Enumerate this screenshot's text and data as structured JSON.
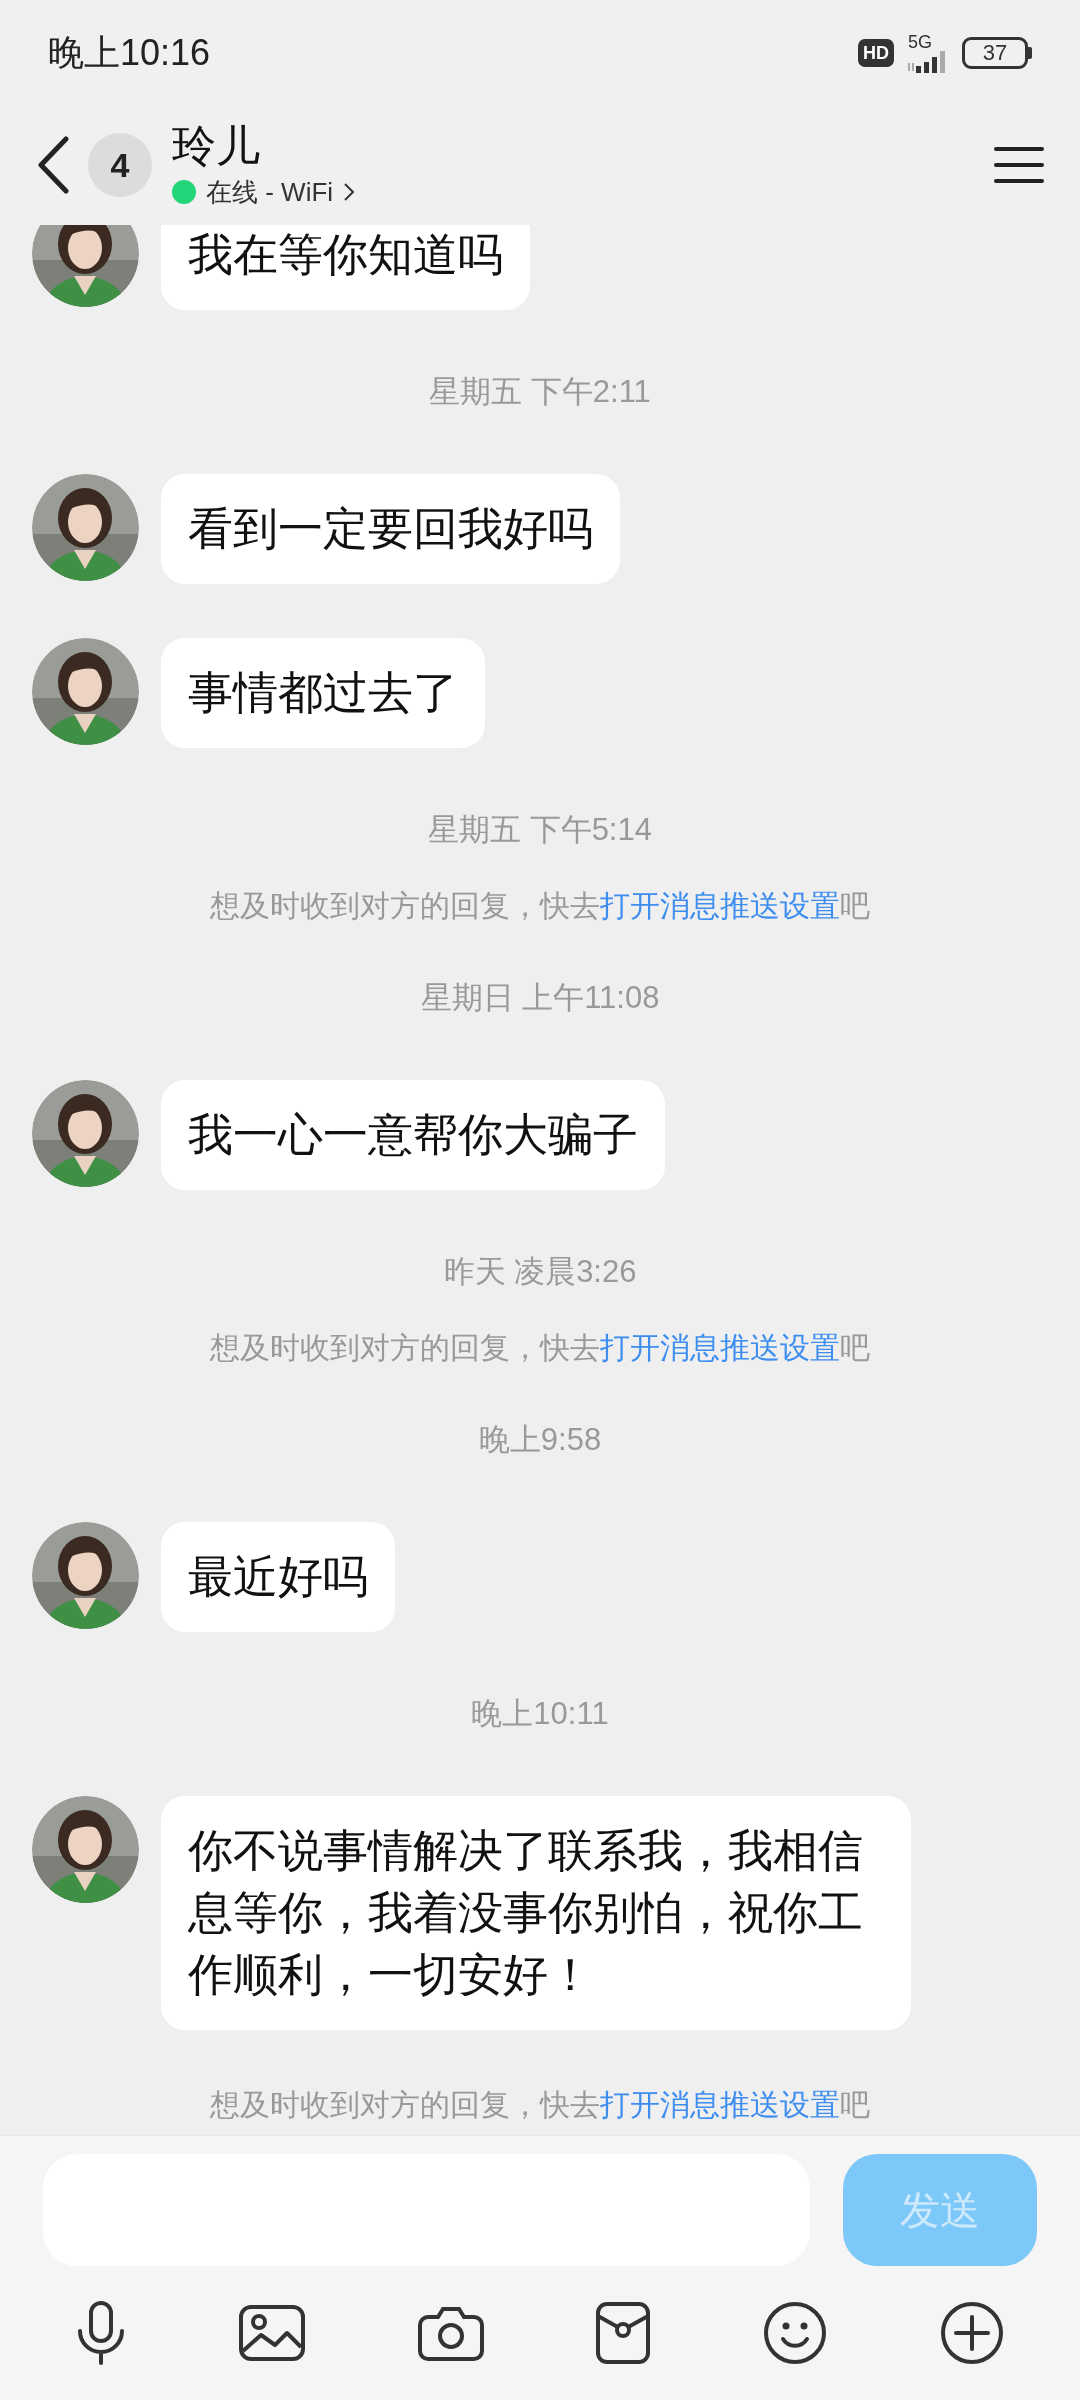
{
  "status_bar": {
    "time": "晚上10:16",
    "hd": "HD",
    "network": "5G",
    "battery": "37"
  },
  "header": {
    "unread": "4",
    "name": "玲儿",
    "online": true,
    "presence": "在线 - WiFi"
  },
  "messages": [
    {
      "kind": "message",
      "text": "我在等你知道吗"
    },
    {
      "kind": "timestamp",
      "text": "星期五 下午2:11"
    },
    {
      "kind": "message",
      "text": "看到一定要回我好吗"
    },
    {
      "kind": "message",
      "text": "事情都过去了"
    },
    {
      "kind": "timestamp",
      "text": "星期五 下午5:14"
    },
    {
      "kind": "notice",
      "before": "想及时收到对方的回复，快去",
      "link": "打开消息推送设置",
      "after": "吧"
    },
    {
      "kind": "timestamp",
      "text": "星期日 上午11:08"
    },
    {
      "kind": "message",
      "text": "我一心一意帮你大骗子"
    },
    {
      "kind": "timestamp",
      "text": "昨天 凌晨3:26"
    },
    {
      "kind": "notice",
      "before": "想及时收到对方的回复，快去",
      "link": "打开消息推送设置",
      "after": "吧"
    },
    {
      "kind": "timestamp",
      "text": "晚上9:58"
    },
    {
      "kind": "message",
      "text": "最近好吗"
    },
    {
      "kind": "timestamp",
      "text": "晚上10:11"
    },
    {
      "kind": "message",
      "text": "你不说事情解决了联系我，我相信息等你，我着没事你别怕，祝你工作顺利，一切安好！"
    },
    {
      "kind": "notice",
      "before": "想及时收到对方的回复，快去",
      "link": "打开消息推送设置",
      "after": "吧"
    }
  ],
  "composer": {
    "send_label": "发送",
    "send_disabled": true
  }
}
